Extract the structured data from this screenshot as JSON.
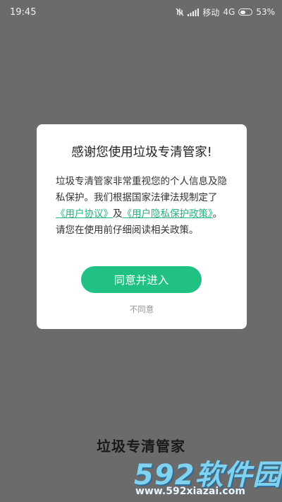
{
  "status_bar": {
    "time": "19:45",
    "carrier": "移动",
    "network": "4G",
    "battery": "53%",
    "battery_level": 0.53
  },
  "dialog": {
    "title": "感谢您使用垃圾专清管家!",
    "body": {
      "text_1": "垃圾专清管家非常重视您的个人信息及隐私保护。我们根据国家法律法规制定了",
      "link_agreement": "《用户协议》",
      "text_2": "及",
      "link_privacy": "《用户隐私保护政策》",
      "text_3": "。请您在使用前仔细阅读相关政策。"
    },
    "agree_label": "同意并进入",
    "disagree_label": "不同意"
  },
  "app_name": "垃圾专清管家",
  "watermark": {
    "main": "592软件园",
    "url": "www.592xiazai.com"
  },
  "colors": {
    "overlay": "#6b6b6b",
    "accent": "#21c184",
    "link": "#23b27c"
  }
}
